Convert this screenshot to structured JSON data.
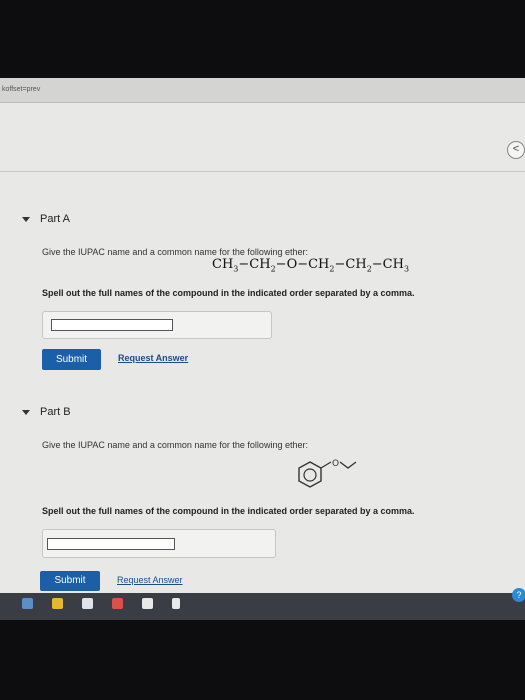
{
  "browser": {
    "url_fragment": "koffset=prev"
  },
  "nav": {
    "back_label": "<"
  },
  "part_a": {
    "title": "Part A",
    "question": "Give the IUPAC name and a common name for the following ether:",
    "formula_parts": [
      "CH",
      "3",
      "−CH",
      "2",
      "−O−CH",
      "2",
      "−CH",
      "2",
      "−CH",
      "3"
    ],
    "instruction": "Spell out the full names of the compound in the indicated order separated by a comma.",
    "answer_value": "",
    "submit_label": "Submit",
    "request_label": "Request Answer"
  },
  "part_b": {
    "title": "Part B",
    "question": "Give the IUPAC name and a common name for the following ether:",
    "instruction": "Spell out the full names of the compound in the indicated order separated by a comma.",
    "answer_value": "",
    "submit_label": "Submit",
    "request_label": "Request Answer"
  },
  "taskbar": {
    "icons": [
      "chrome-icon",
      "store-icon",
      "dropbox-icon",
      "office-icon",
      "mail-icon",
      "flag-icon"
    ],
    "help_label": "?"
  }
}
